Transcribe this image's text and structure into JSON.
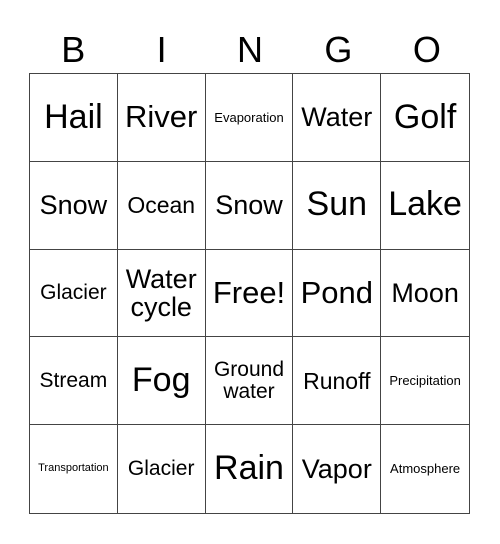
{
  "header": {
    "letters": [
      "B",
      "I",
      "N",
      "G",
      "O"
    ]
  },
  "cells": [
    {
      "text": "Hail",
      "size": "xl"
    },
    {
      "text": "River",
      "size": "l"
    },
    {
      "text": "Evaporation",
      "size": "xs"
    },
    {
      "text": "Water",
      "size": "m"
    },
    {
      "text": "Golf",
      "size": "xl"
    },
    {
      "text": "Snow",
      "size": "m"
    },
    {
      "text": "Ocean",
      "size": "ms"
    },
    {
      "text": "Snow",
      "size": "m"
    },
    {
      "text": "Sun",
      "size": "xl"
    },
    {
      "text": "Lake",
      "size": "xl"
    },
    {
      "text": "Glacier",
      "size": "s"
    },
    {
      "text": "Water cycle",
      "size": "m"
    },
    {
      "text": "Free!",
      "size": "l"
    },
    {
      "text": "Pond",
      "size": "l"
    },
    {
      "text": "Moon",
      "size": "m"
    },
    {
      "text": "Stream",
      "size": "s"
    },
    {
      "text": "Fog",
      "size": "xl"
    },
    {
      "text": "Ground water",
      "size": "s"
    },
    {
      "text": "Runoff",
      "size": "ms"
    },
    {
      "text": "Precipitation",
      "size": "xs"
    },
    {
      "text": "Transportation",
      "size": "xxs"
    },
    {
      "text": "Glacier",
      "size": "s"
    },
    {
      "text": "Rain",
      "size": "xl"
    },
    {
      "text": "Vapor",
      "size": "m"
    },
    {
      "text": "Atmosphere",
      "size": "xs"
    }
  ]
}
